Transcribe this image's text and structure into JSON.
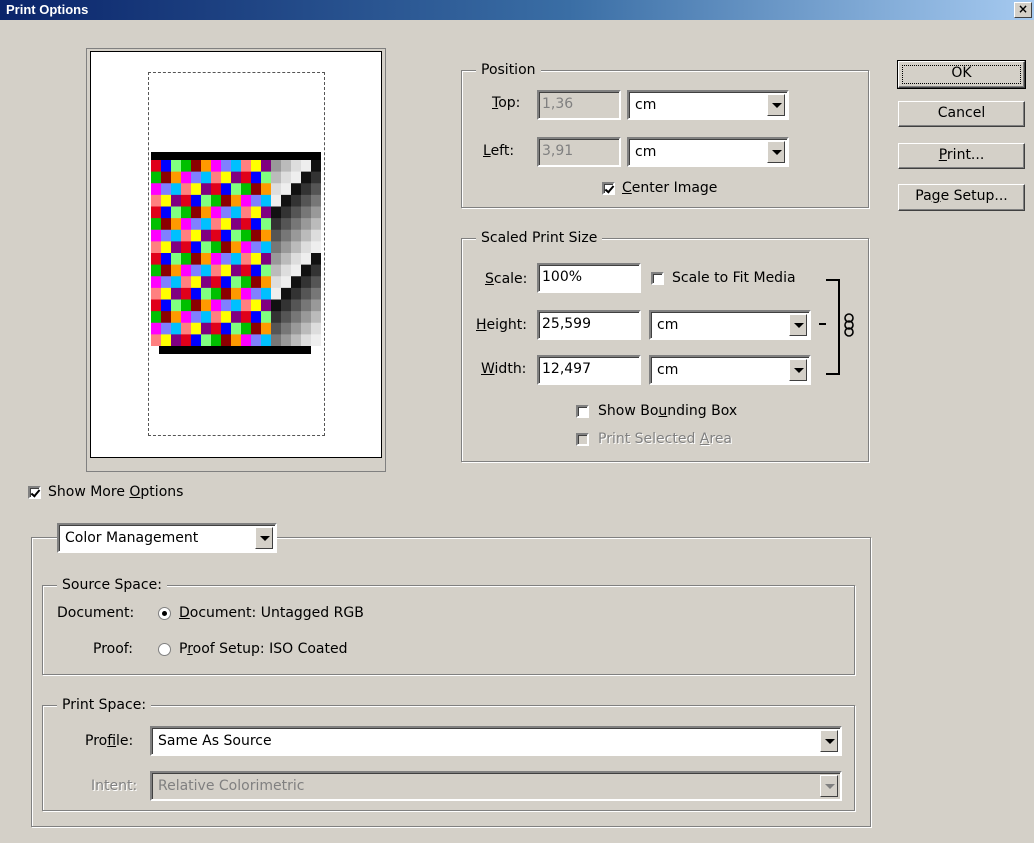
{
  "window": {
    "title": "Print Options",
    "close_glyph": "×"
  },
  "preview": {
    "chart_colors": [
      "#e0001a",
      "#ff9900",
      "#ffff00",
      "#00c000",
      "#00c0ff",
      "#0000ff",
      "#ff00ff",
      "#800080",
      "#8b0000",
      "#ff8080",
      "#80ff80",
      "#8080ff",
      "#000000",
      "#404040",
      "#808080",
      "#c0c0c0",
      "#ffffff"
    ]
  },
  "position": {
    "legend": "Position",
    "top_label_u": "T",
    "top_label_rest": "op:",
    "top_value": "1,36",
    "top_unit": "cm",
    "left_label_u": "L",
    "left_label_rest": "eft:",
    "left_value": "3,91",
    "left_unit": "cm",
    "center_image_u": "C",
    "center_image_rest": "enter Image",
    "center_image_checked": true
  },
  "scaled": {
    "legend": "Scaled Print Size",
    "scale_label_u": "S",
    "scale_label_rest": "cale:",
    "scale_value": "100%",
    "scale_to_fit": "Scale to Fit Media",
    "height_label_u": "H",
    "height_label_rest": "eight:",
    "height_value": "25,599",
    "height_unit": "cm",
    "width_label_u": "W",
    "width_label_rest": "idth:",
    "width_value": "12,497",
    "width_unit": "cm",
    "bounding_pre": "Show Bo",
    "bounding_u": "u",
    "bounding_post": "nding Box",
    "print_sel_pre": "Print Selected ",
    "print_sel_u": "A",
    "print_sel_post": "rea"
  },
  "buttons": {
    "ok": "OK",
    "cancel": "Cancel",
    "print_u": "P",
    "print_rest": "rint...",
    "page_setup_pre": "Pa",
    "page_setup_u": "g",
    "page_setup_post": "e Setup..."
  },
  "more": {
    "pre": "Show More ",
    "u": "O",
    "post": "ptions",
    "checked": true
  },
  "color_mgmt": {
    "dropdown": "Color Management",
    "source_legend": "Source Space:",
    "document_label": "Document:",
    "document_radio_u": "D",
    "document_radio_rest": "ocument:",
    "document_value": "Untagged RGB",
    "proof_label": "Proof:",
    "proof_radio_pre": "P",
    "proof_radio_u": "r",
    "proof_radio_rest": "oof Setup:",
    "proof_value": "ISO Coated",
    "print_legend": "Print Space:",
    "profile_pre": "Pro",
    "profile_u": "f",
    "profile_post": "ile:",
    "profile_value": "Same As Source",
    "intent_label": "Intent:",
    "intent_value": "Relative Colorimetric"
  }
}
